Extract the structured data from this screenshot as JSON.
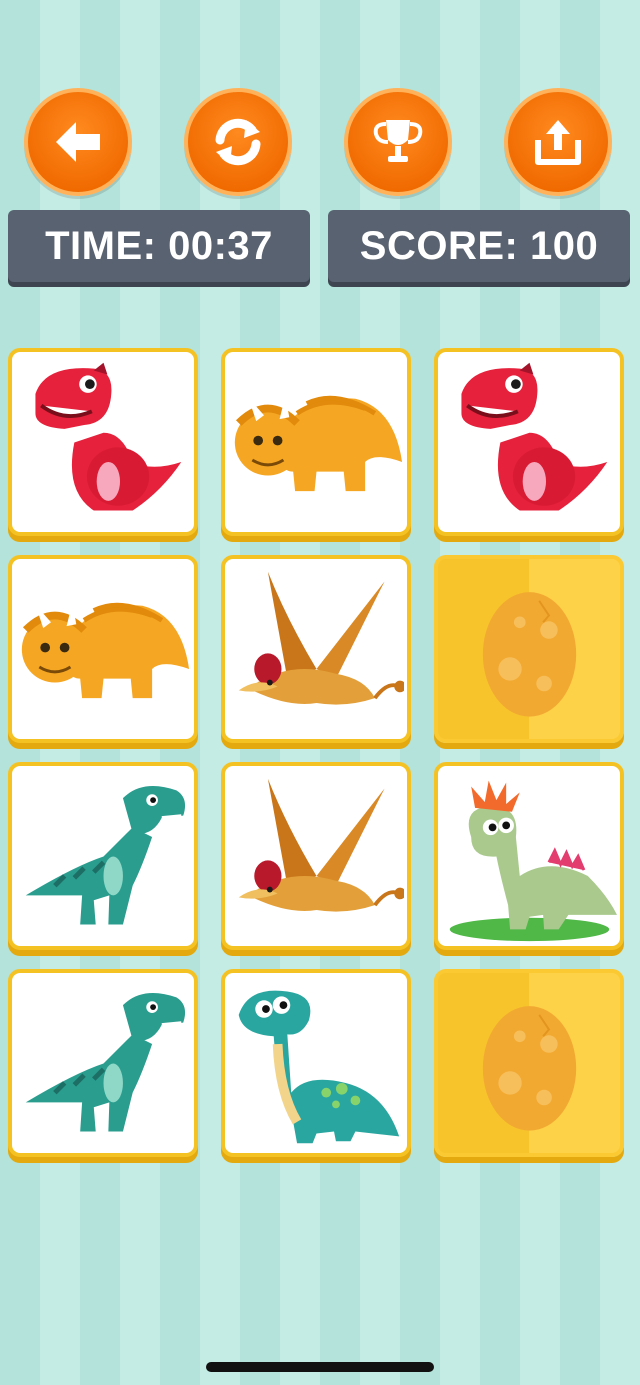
{
  "toolbar": {
    "buttons": [
      {
        "icon": "back-arrow-icon"
      },
      {
        "icon": "refresh-icon"
      },
      {
        "icon": "trophy-icon"
      },
      {
        "icon": "share-icon"
      }
    ],
    "accent": "#f06a00"
  },
  "stats": {
    "time_label": "TIME: 00:37",
    "score_label": "SCORE: 100"
  },
  "board": {
    "rows": 4,
    "cols": 3,
    "cards": [
      {
        "state": "face-up",
        "icon": "red-trex-icon"
      },
      {
        "state": "face-up",
        "icon": "orange-triceratops-icon"
      },
      {
        "state": "face-up",
        "icon": "red-trex-icon"
      },
      {
        "state": "face-up",
        "icon": "orange-triceratops-icon"
      },
      {
        "state": "face-up",
        "icon": "pterodactyl-icon"
      },
      {
        "state": "face-down",
        "icon": "egg-icon"
      },
      {
        "state": "face-up",
        "icon": "green-trex-icon"
      },
      {
        "state": "face-up",
        "icon": "pterodactyl-icon"
      },
      {
        "state": "face-up",
        "icon": "spiky-haired-dino-icon"
      },
      {
        "state": "face-up",
        "icon": "green-trex-icon"
      },
      {
        "state": "face-up",
        "icon": "teal-brontosaurus-icon"
      },
      {
        "state": "face-down",
        "icon": "egg-icon"
      }
    ],
    "card_back_color": "#f8c42c",
    "card_border_color": "#f5c224"
  }
}
